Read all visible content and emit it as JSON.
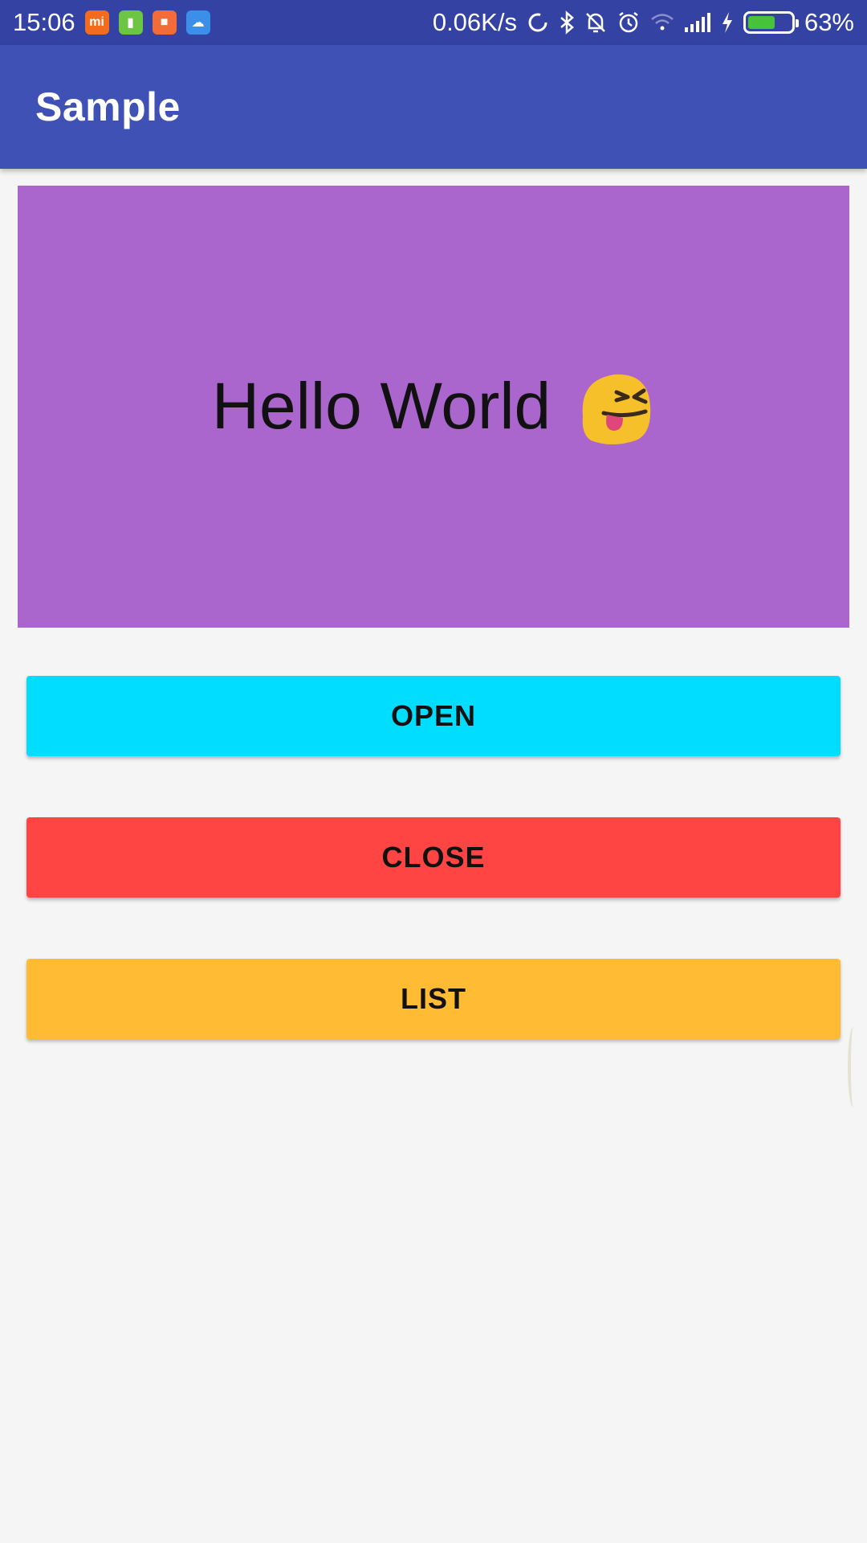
{
  "status_bar": {
    "time": "15:06",
    "network_speed": "0.06K/s",
    "battery_percent": "63%",
    "battery_level": 0.63,
    "notification_icons": [
      "mi-app-icon",
      "sim-manager-icon",
      "video-icon",
      "cloud-icon"
    ],
    "system_icons": [
      "sync-icon",
      "bluetooth-icon",
      "bell-off-icon",
      "alarm-icon",
      "wifi-icon",
      "signal-icon",
      "charging-icon",
      "battery-icon"
    ]
  },
  "app_bar": {
    "title": "Sample",
    "color": "#3f51b5"
  },
  "hero": {
    "text": "Hello World",
    "emoji": "squinting-tongue-face-icon",
    "background": "#aa66cc"
  },
  "buttons": {
    "open": {
      "label": "OPEN",
      "color": "#00ddff"
    },
    "close": {
      "label": "CLOSE",
      "color": "#ff4444"
    },
    "list": {
      "label": "LIST",
      "color": "#ffbb33"
    }
  }
}
